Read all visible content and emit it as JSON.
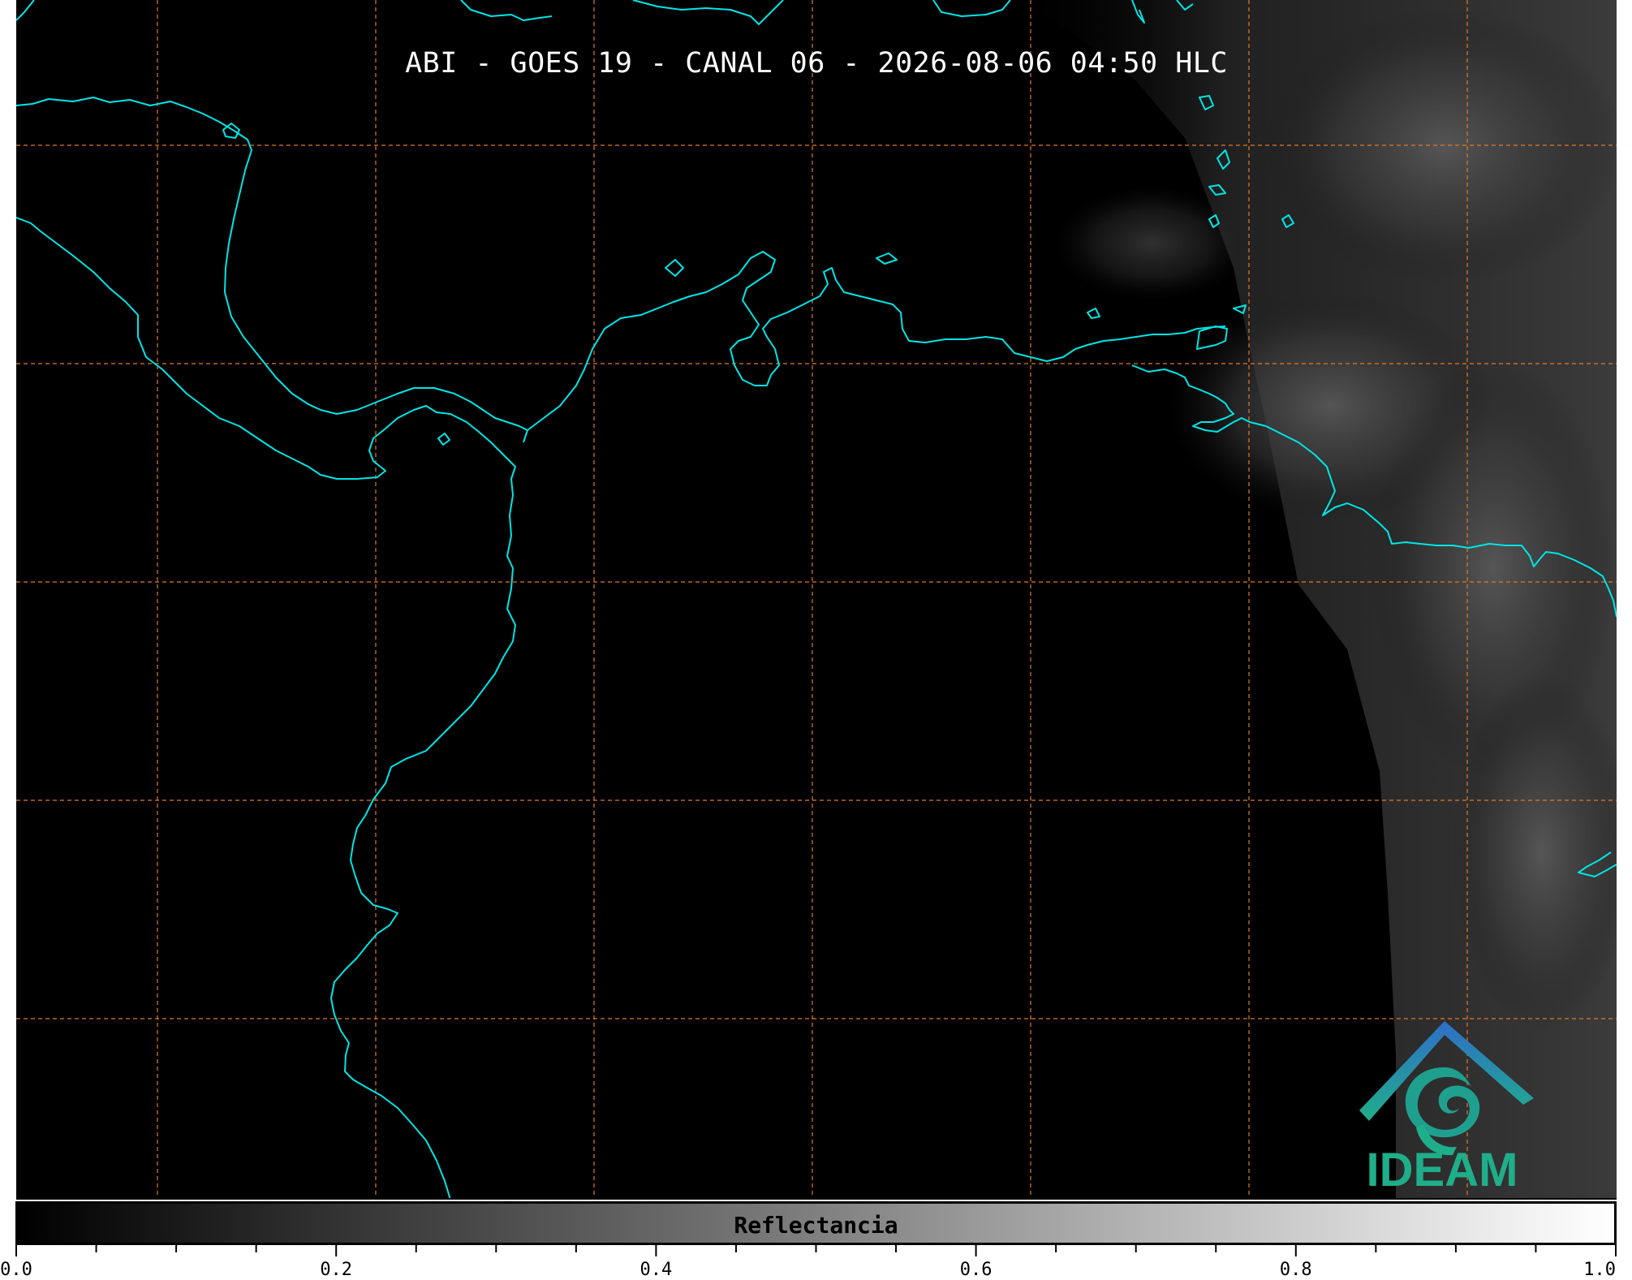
{
  "title": "ABI - GOES 19 - CANAL 06 - 2026-08-06 04:50 HLC",
  "logo": {
    "text": "IDEAM",
    "icon": "ideam-logo-icon"
  },
  "colorbar": {
    "label": "Reflectancia",
    "min": 0.0,
    "max": 1.0,
    "ticks": [
      "0.0",
      "0.2",
      "0.4",
      "0.6",
      "0.8",
      "1.0"
    ],
    "colormap": [
      "#000000",
      "#ffffff"
    ]
  },
  "colors": {
    "coastline": "#00e5e5",
    "gridlines": "#e07a28",
    "background": "#000000",
    "logo_blue": "#2f86c8",
    "logo_green": "#1fae8a"
  },
  "grid": {
    "meridians": 7,
    "parallels": 5,
    "style": "dashed"
  }
}
